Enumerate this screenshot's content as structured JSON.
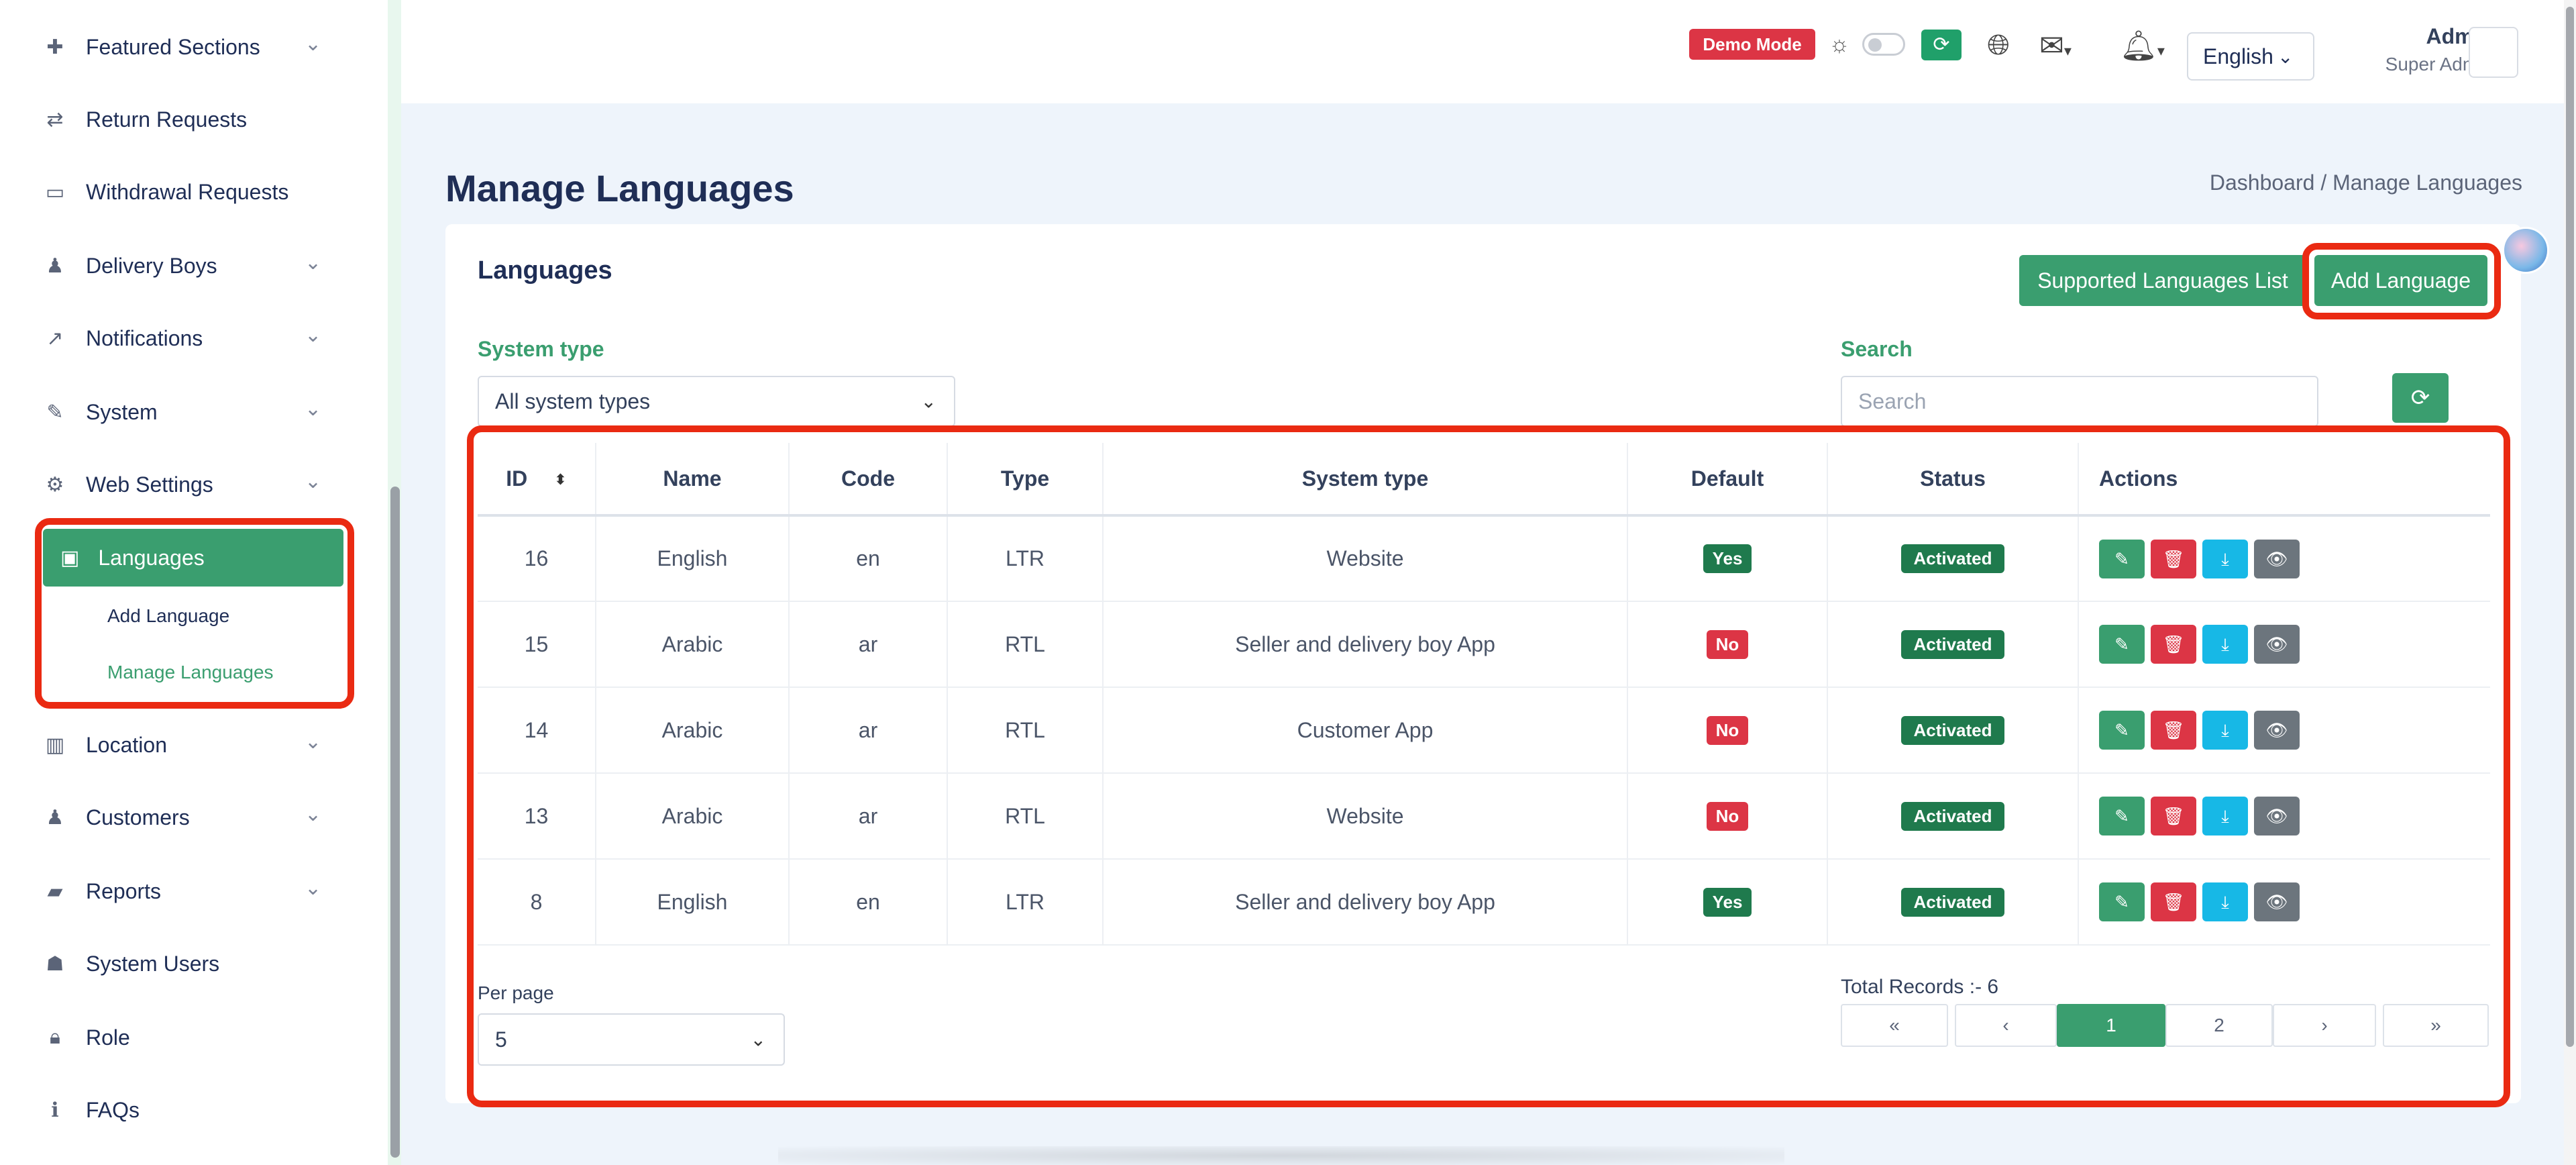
{
  "sidebar": {
    "items": [
      {
        "label": "Featured Sections",
        "icon": "puzzle-icon",
        "has_children": true
      },
      {
        "label": "Return Requests",
        "icon": "return-icon",
        "has_children": false
      },
      {
        "label": "Withdrawal Requests",
        "icon": "card-icon",
        "has_children": false
      },
      {
        "label": "Delivery Boys",
        "icon": "person-icon",
        "has_children": true
      },
      {
        "label": "Notifications",
        "icon": "share-icon",
        "has_children": true
      },
      {
        "label": "System",
        "icon": "wrench-icon",
        "has_children": true
      },
      {
        "label": "Web Settings",
        "icon": "gear-icon",
        "has_children": true
      },
      {
        "label": "Languages",
        "icon": "language-icon",
        "active": true
      },
      {
        "label": "Location",
        "icon": "map-icon",
        "has_children": true
      },
      {
        "label": "Customers",
        "icon": "person-icon",
        "has_children": true
      },
      {
        "label": "Reports",
        "icon": "folder-icon",
        "has_children": true
      },
      {
        "label": "System Users",
        "icon": "users-icon",
        "has_children": false
      },
      {
        "label": "Role",
        "icon": "lock-icon",
        "has_children": false
      },
      {
        "label": "FAQs",
        "icon": "info-icon",
        "has_children": false
      }
    ],
    "sub_items": [
      {
        "label": "Add Language",
        "active": false
      },
      {
        "label": "Manage Languages",
        "active": true
      }
    ]
  },
  "header": {
    "demo_badge": "Demo Mode",
    "language": "English",
    "user_name": "Admin",
    "user_role": "Super Admin"
  },
  "page": {
    "title": "Manage Languages",
    "breadcrumb": "Dashboard  /  Manage Languages"
  },
  "card": {
    "title": "Languages",
    "supported_btn": "Supported Languages List",
    "add_btn": "Add Language",
    "system_type_label": "System type",
    "system_type_value": "All system types",
    "search_label": "Search",
    "search_placeholder": "Search"
  },
  "table": {
    "columns": [
      "ID",
      "Name",
      "Code",
      "Type",
      "System type",
      "Default",
      "Status",
      "Actions"
    ],
    "rows": [
      {
        "id": "16",
        "name": "English",
        "code": "en",
        "type": "LTR",
        "system_type": "Website",
        "default": "Yes",
        "status": "Activated"
      },
      {
        "id": "15",
        "name": "Arabic",
        "code": "ar",
        "type": "RTL",
        "system_type": "Seller and delivery boy App",
        "default": "No",
        "status": "Activated"
      },
      {
        "id": "14",
        "name": "Arabic",
        "code": "ar",
        "type": "RTL",
        "system_type": "Customer App",
        "default": "No",
        "status": "Activated"
      },
      {
        "id": "13",
        "name": "Arabic",
        "code": "ar",
        "type": "RTL",
        "system_type": "Website",
        "default": "No",
        "status": "Activated"
      },
      {
        "id": "8",
        "name": "English",
        "code": "en",
        "type": "LTR",
        "system_type": "Seller and delivery boy App",
        "default": "Yes",
        "status": "Activated"
      }
    ]
  },
  "footer": {
    "per_page_label": "Per page",
    "per_page_value": "5",
    "total_records": "Total Records :- 6",
    "pager": [
      "«",
      "‹",
      "1",
      "2",
      "›",
      "»"
    ],
    "current_page": "1"
  },
  "colors": {
    "accent": "#3a9e6f",
    "danger": "#dc3545",
    "highlight": "#ea2a12"
  }
}
